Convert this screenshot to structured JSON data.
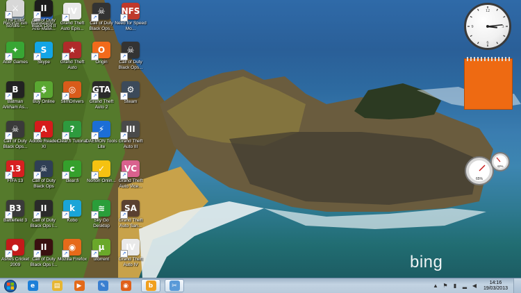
{
  "desktop_icons": [
    {
      "label": "Recycle Bin",
      "color": "#8aa0b4",
      "glyph": "♻",
      "shortcut": false
    },
    {
      "label": "Malwareby... Anti-Malw...",
      "color": "#2b6cd1",
      "glyph": "M",
      "shortcut": true
    },
    {
      "label": "Grand Theft Auto Epis...",
      "color": "#e9e9e9",
      "glyph": "IV",
      "shortcut": true
    },
    {
      "label": "Call of Duty Black Ops...",
      "color": "#333333",
      "glyph": "☠",
      "shortcut": true
    },
    {
      "label": "Need for Speed Mo...",
      "color": "#c0392b",
      "glyph": "NFS",
      "shortcut": true
    },
    {
      "label": "Acer Games",
      "color": "#38a634",
      "glyph": "✦",
      "shortcut": true
    },
    {
      "label": "Skype",
      "color": "#12a5e6",
      "glyph": "S",
      "shortcut": true
    },
    {
      "label": "Grand Theft Auto",
      "color": "#b02a2a",
      "glyph": "★",
      "shortcut": true
    },
    {
      "label": "Origin",
      "color": "#f26a1b",
      "glyph": "O",
      "shortcut": true
    },
    {
      "label": "Call of Duty Black Ops...",
      "color": "#333333",
      "glyph": "☠",
      "shortcut": true
    },
    {
      "label": "Batman Arkham As...",
      "color": "#222222",
      "glyph": "B",
      "shortcut": true
    },
    {
      "label": "Buy Online",
      "color": "#5aa832",
      "glyph": "$",
      "shortcut": true
    },
    {
      "label": "SlimDrivers",
      "color": "#d95b1a",
      "glyph": "◎",
      "shortcut": true
    },
    {
      "label": "Grand Theft Auto 2",
      "color": "#2a2a2a",
      "glyph": "GTA",
      "shortcut": true
    },
    {
      "label": "Steam",
      "color": "#3c4a5a",
      "glyph": "⚙",
      "shortcut": true
    },
    {
      "label": "Call of Duty Black Ops...",
      "color": "#3a3a3a",
      "glyph": "☠",
      "shortcut": true
    },
    {
      "label": "Adobe Reader XI",
      "color": "#d61b1b",
      "glyph": "A",
      "shortcut": true
    },
    {
      "label": "Clear.fi Tutorial",
      "color": "#2e9a3e",
      "glyph": "?",
      "shortcut": true
    },
    {
      "label": "DAEMON Tools Lite",
      "color": "#1c6ed6",
      "glyph": "⚡",
      "shortcut": true
    },
    {
      "label": "Grand Theft Auto III",
      "color": "#4a4a4a",
      "glyph": "III",
      "shortcut": true
    },
    {
      "label": "FIFA 13",
      "color": "#d72020",
      "glyph": "13",
      "shortcut": true
    },
    {
      "label": "Call of Duty Black Ops",
      "color": "#2f3f55",
      "glyph": "☠",
      "shortcut": true
    },
    {
      "label": "clear.fi",
      "color": "#35a02c",
      "glyph": "c",
      "shortcut": true
    },
    {
      "label": "Norton Onlin...",
      "color": "#f5c211",
      "glyph": "✓",
      "shortcut": true
    },
    {
      "label": "Grand Theft Auto Vice...",
      "color": "#d9618e",
      "glyph": "VC",
      "shortcut": true
    },
    {
      "label": "Battlefield 3",
      "color": "#3a3a3a",
      "glyph": "B3",
      "shortcut": true
    },
    {
      "label": "Call of Duty Black Ops I...",
      "color": "#2a2a2a",
      "glyph": "II",
      "shortcut": true
    },
    {
      "label": "Kobo",
      "color": "#1aa5d8",
      "glyph": "k",
      "shortcut": true
    },
    {
      "label": "Sky Go Desktop",
      "color": "#2a9e3a",
      "glyph": "≋",
      "shortcut": true
    },
    {
      "label": "Grand Theft Auto San...",
      "color": "#5a4030",
      "glyph": "SA",
      "shortcut": true
    },
    {
      "label": "Ashes Cricket 2009",
      "color": "#c41a1a",
      "glyph": "●",
      "shortcut": true
    },
    {
      "label": "Call of Duty Black Ops I...",
      "color": "#3a1010",
      "glyph": "II",
      "shortcut": true
    },
    {
      "label": "Mozilla Firefox",
      "color": "#e66a1a",
      "glyph": "◉",
      "shortcut": true
    },
    {
      "label": "utorrent",
      "color": "#6aa82a",
      "glyph": "µ",
      "shortcut": true
    },
    {
      "label": "Grand Theft Auto IV",
      "color": "#e9e9e9",
      "glyph": "IV",
      "shortcut": true
    },
    {
      "label": "The Elder Scrolls ...",
      "color": "#d8d8d8",
      "glyph": "⚔",
      "shortcut": true
    },
    {
      "label": "Call of Duty Black Ops II",
      "color": "#1c1c1c",
      "glyph": "II",
      "shortcut": true
    }
  ],
  "gadgets": {
    "clock": {
      "hour": 3,
      "minute": 14
    },
    "notes_color": "#ee6a12",
    "meter": {
      "cpu": "65%",
      "ram": "42%"
    }
  },
  "watermark": "bing",
  "taskbar": {
    "pinned": [
      {
        "name": "ie",
        "glyph": "e",
        "color": "#1d7fd8"
      },
      {
        "name": "explorer",
        "glyph": "▤",
        "color": "#e7b632"
      },
      {
        "name": "media-player",
        "glyph": "▶",
        "color": "#e36a1a"
      },
      {
        "name": "control-panel",
        "glyph": "✎",
        "color": "#3a7fd0"
      },
      {
        "name": "firefox",
        "glyph": "◉",
        "color": "#e0601a"
      },
      {
        "name": "bing",
        "glyph": "b",
        "color": "#f0a020"
      },
      {
        "name": "snipping",
        "glyph": "✂",
        "color": "#5a9ad8"
      }
    ],
    "time": "14:16",
    "date": "19/03/2013"
  }
}
